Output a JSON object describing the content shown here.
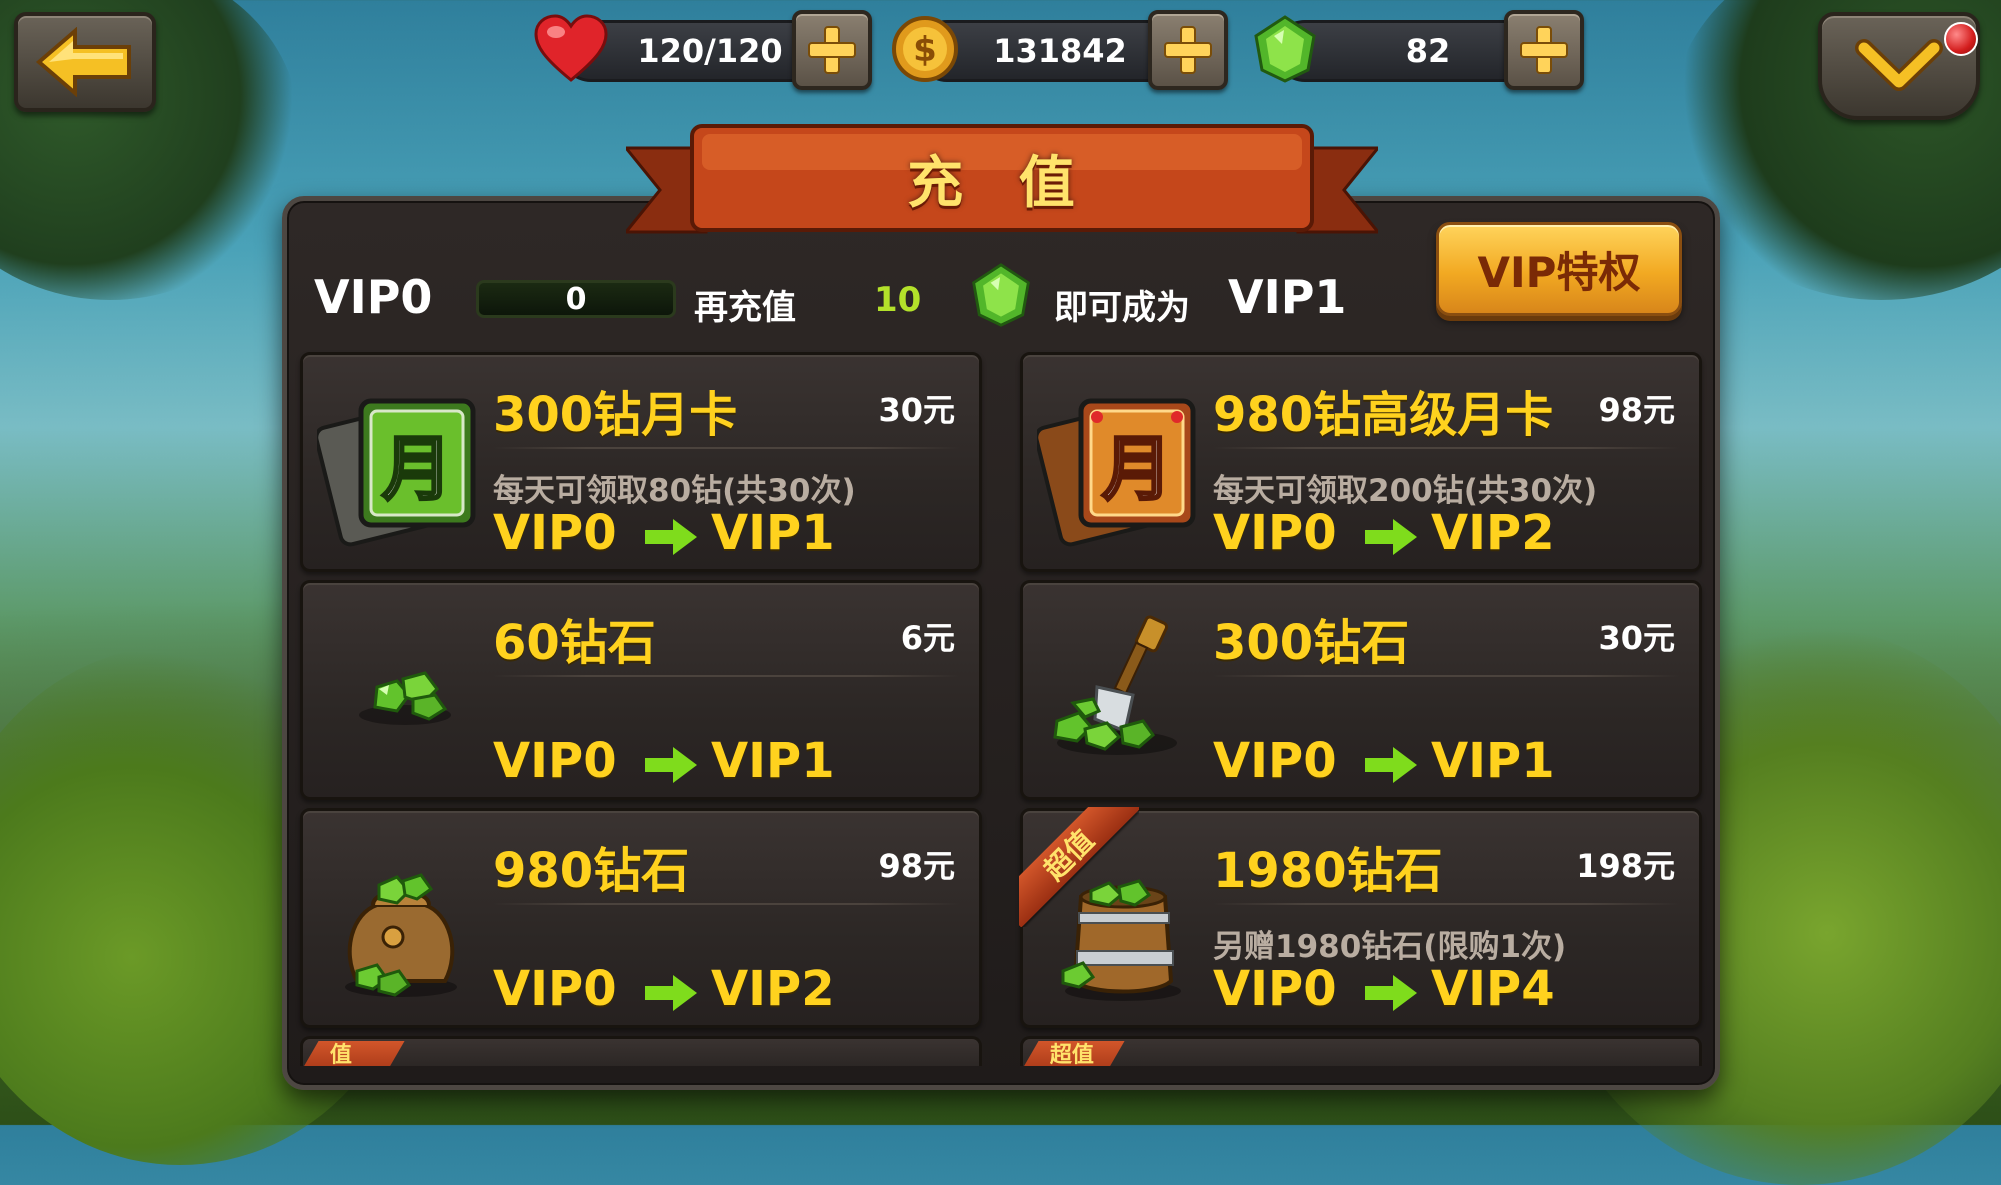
{
  "top_bar": {
    "hearts": "120/120",
    "coins": "131842",
    "gems": "82"
  },
  "panel": {
    "title": "充 值",
    "current_vip": "VIP0",
    "progress_value": "0",
    "recharge_prefix": "再充值",
    "recharge_amount": "10",
    "become_text": "即可成为",
    "next_vip": "VIP1",
    "vip_privilege_label": "VIP特权"
  },
  "packages": [
    {
      "name": "300钻月卡",
      "price": "30元",
      "desc": "每天可领取80钻(共30次)",
      "from": "VIP0",
      "to": "VIP1",
      "badge": ""
    },
    {
      "name": "980钻高级月卡",
      "price": "98元",
      "desc": "每天可领取200钻(共30次)",
      "from": "VIP0",
      "to": "VIP2",
      "badge": ""
    },
    {
      "name": "60钻石",
      "price": "6元",
      "desc": "",
      "from": "VIP0",
      "to": "VIP1",
      "badge": ""
    },
    {
      "name": "300钻石",
      "price": "30元",
      "desc": "",
      "from": "VIP0",
      "to": "VIP1",
      "badge": ""
    },
    {
      "name": "980钻石",
      "price": "98元",
      "desc": "",
      "from": "VIP0",
      "to": "VIP2",
      "badge": ""
    },
    {
      "name": "1980钻石",
      "price": "198元",
      "desc": "另赠1980钻石(限购1次)",
      "from": "VIP0",
      "to": "VIP4",
      "badge": "超值"
    }
  ],
  "partial_badges": [
    "值",
    "超值"
  ],
  "colors": {
    "gold_text": "#ffd21e",
    "green_arrow": "#7fdc1c",
    "banner": "#c5471b",
    "button_gold": "#f2a922"
  },
  "icons": {
    "back": "arrow-left-icon",
    "menu": "chevron-down-icon",
    "heart": "heart-icon",
    "coin": "coin-icon",
    "gem": "gem-icon",
    "plus": "plus-icon",
    "arrow": "arrow-right-icon"
  }
}
